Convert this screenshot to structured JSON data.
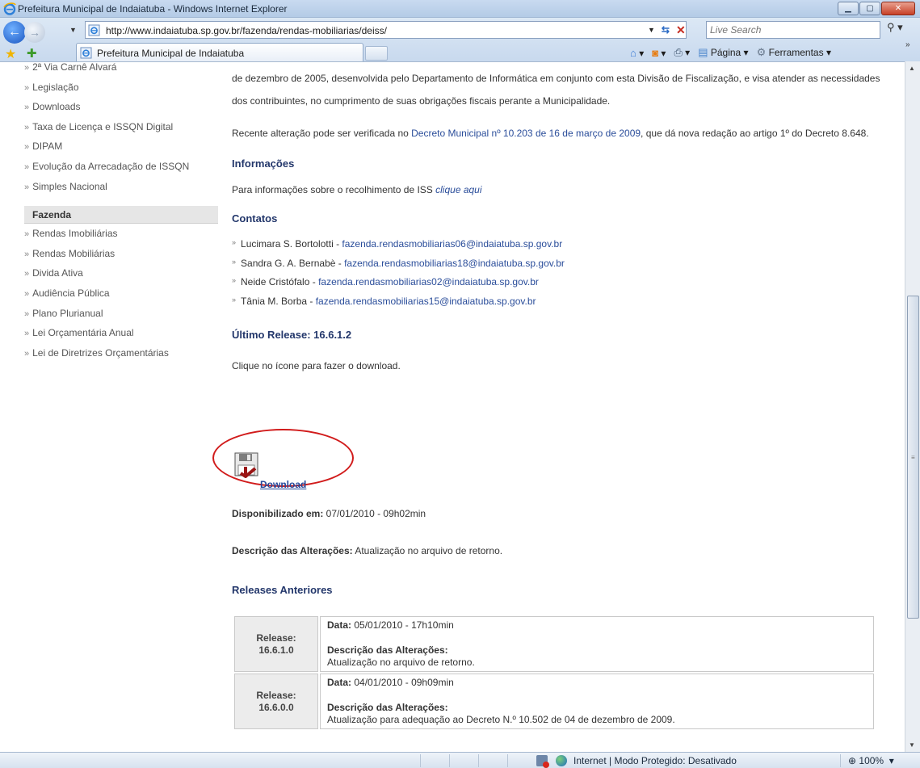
{
  "window": {
    "title": "Prefeitura Municipal de Indaiatuba - Windows Internet Explorer"
  },
  "address": {
    "url": "http://www.indaiatuba.sp.gov.br/fazenda/rendas-mobiliarias/deiss/",
    "search_placeholder": "Live Search"
  },
  "tab": {
    "label": "Prefeitura Municipal de Indaiatuba"
  },
  "commands": {
    "page": "Página",
    "tools": "Ferramentas"
  },
  "sidebar": {
    "items_top": [
      "2ª Via Carnê Alvará",
      "Legislação",
      "Downloads",
      "Taxa de Licença e ISSQN Digital",
      "DIPAM",
      "Evolução da Arrecadação de ISSQN",
      "Simples Nacional"
    ],
    "heading": "Fazenda",
    "items_fazenda": [
      "Rendas Imobiliárias",
      "Rendas Mobiliárias",
      "Divida Ativa",
      "Audiência Pública",
      "Plano Plurianual",
      "Lei Orçamentária Anual",
      "Lei de Diretrizes Orçamentárias"
    ]
  },
  "content": {
    "intro": "de dezembro de 2005, desenvolvida pelo Departamento de Informática em conjunto com esta Divisão de Fiscalização, e visa atender as necessidades dos contribuintes, no cumprimento de suas obrigações fiscais perante a Municipalidade.",
    "recent_prefix": "Recente alteração pode ser verificada no ",
    "recent_link": "Decreto Municipal nº 10.203 de 16 de março de 2009",
    "recent_suffix": ", que dá nova redação ao artigo 1º do Decreto 8.648.",
    "info_heading": "Informações",
    "info_text": "Para informações sobre o recolhimento de ISS ",
    "info_link": "clique aqui",
    "contacts_heading": "Contatos",
    "contacts": [
      {
        "name": "Lucimara S. Bortolotti - ",
        "email": "fazenda.rendasmobiliarias06@indaiatuba.sp.gov.br"
      },
      {
        "name": "Sandra G. A. Bernabè - ",
        "email": "fazenda.rendasmobiliarias18@indaiatuba.sp.gov.br"
      },
      {
        "name": "Neide Cristófalo - ",
        "email": "fazenda.rendasmobiliarias02@indaiatuba.sp.gov.br"
      },
      {
        "name": "Tânia M. Borba - ",
        "email": "fazenda.rendasmobiliarias15@indaiatuba.sp.gov.br"
      }
    ],
    "release_heading": "Último Release: 16.6.1.2",
    "click_text": "Clique no ícone para fazer o download.",
    "download_label": "Download",
    "available_label": "Disponibilizado em:",
    "available_value": " 07/01/2010 - 09h02min",
    "changes_label": "Descrição das Alterações:",
    "changes_value": " Atualização no arquivo de retorno.",
    "previous_heading": "Releases Anteriores",
    "releases": [
      {
        "release_label": "Release:",
        "version": "16.6.1.0",
        "date_label": "Data:",
        "date": " 05/01/2010 - 17h10min",
        "desc_label": "Descrição das Alterações:",
        "desc": "Atualização no arquivo de retorno."
      },
      {
        "release_label": "Release:",
        "version": "16.6.0.0",
        "date_label": "Data:",
        "date": " 04/01/2010 - 09h09min",
        "desc_label": "Descrição das Alterações:",
        "desc": "Atualização para adequação ao Decreto N.º 10.502 de 04 de dezembro de 2009."
      }
    ]
  },
  "status": {
    "zone": "Internet | Modo Protegido: Desativado",
    "zoom": "100%"
  }
}
